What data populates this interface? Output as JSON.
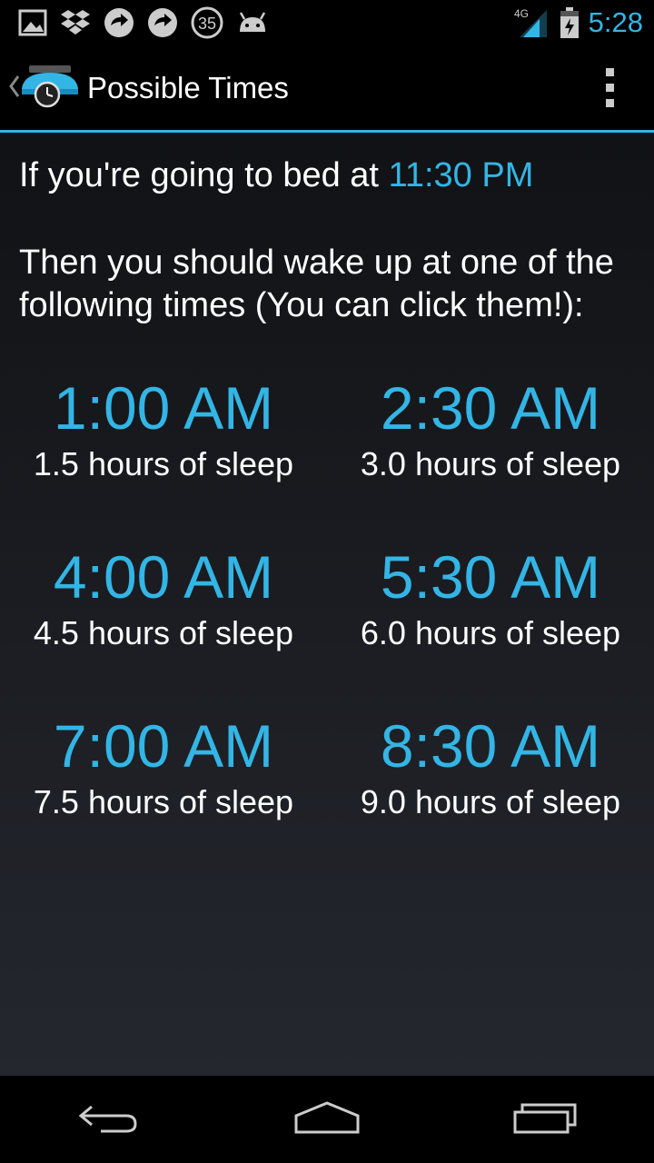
{
  "status_bar": {
    "icons": [
      "gallery-icon",
      "dropbox-icon",
      "sync-icon",
      "sync-icon",
      "badge-35",
      "android-icon"
    ],
    "badge_count": "35",
    "network_label": "4G",
    "time": "5:28"
  },
  "action_bar": {
    "title": "Possible Times",
    "up_icon": "back-chevron-icon",
    "app_icon": "sleep-alarm-app-icon",
    "menu_icon": "overflow-menu-icon"
  },
  "main": {
    "bed_prefix": "If you're going to bed at",
    "bed_time": "11:30 PM",
    "instruction": "Then you should wake up at one of the following times (You can click them!):",
    "times": [
      {
        "time": "1:00 AM",
        "hours": "1.5 hours of sleep"
      },
      {
        "time": "2:30 AM",
        "hours": "3.0 hours of sleep"
      },
      {
        "time": "4:00 AM",
        "hours": "4.5 hours of sleep"
      },
      {
        "time": "5:30 AM",
        "hours": "6.0 hours of sleep"
      },
      {
        "time": "7:00 AM",
        "hours": "7.5 hours of sleep"
      },
      {
        "time": "8:30 AM",
        "hours": "9.0 hours of sleep"
      }
    ]
  },
  "nav_bar": {
    "back_icon": "back-icon",
    "home_icon": "home-icon",
    "recents_icon": "recents-icon"
  },
  "colors": {
    "accent": "#33b5e5",
    "background_top": "#111215",
    "background_bottom": "#24272e",
    "text": "#ffffff"
  }
}
